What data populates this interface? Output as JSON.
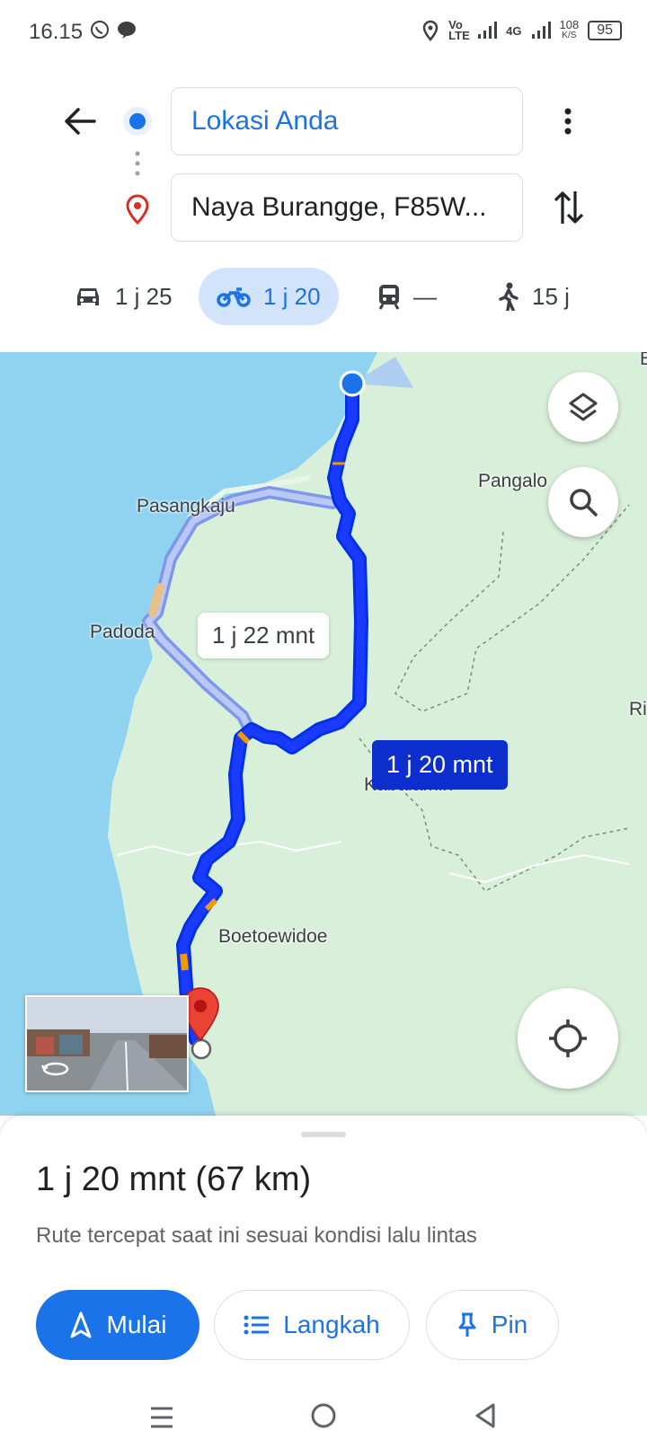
{
  "status_bar": {
    "time": "16.15",
    "volte": "Vo LTE",
    "network": "4G",
    "speed_value": "108",
    "speed_unit": "K/S",
    "battery": "95"
  },
  "header": {
    "origin": "Lokasi Anda",
    "destination": "Naya Burangge, F85W..."
  },
  "modes": [
    {
      "icon": "car-icon",
      "label": "1 j 25"
    },
    {
      "icon": "motorcycle-icon",
      "label": "1 j 20",
      "active": true
    },
    {
      "icon": "train-icon",
      "label": "—"
    },
    {
      "icon": "walk-icon",
      "label": "15 j"
    }
  ],
  "map": {
    "places": [
      "Pasangkaju",
      "Padoda",
      "Pangalo",
      "Kabalamin",
      "Boetoewidoe",
      "Ri",
      "E"
    ],
    "route_labels": {
      "alternate": "1 j 22 mnt",
      "selected": "1 j 20 mnt"
    },
    "colors": {
      "water": "#8fd3f0",
      "land": "#d8efd9",
      "route": "#1a3bff",
      "alt_route": "#a9b8f0",
      "traffic": "#f29900"
    }
  },
  "sheet": {
    "title": "1 j 20 mnt (67 km)",
    "subtitle": "Rute tercepat saat ini sesuai kondisi lalu lintas",
    "buttons": {
      "start": "Mulai",
      "steps": "Langkah",
      "pin": "Pin"
    }
  }
}
